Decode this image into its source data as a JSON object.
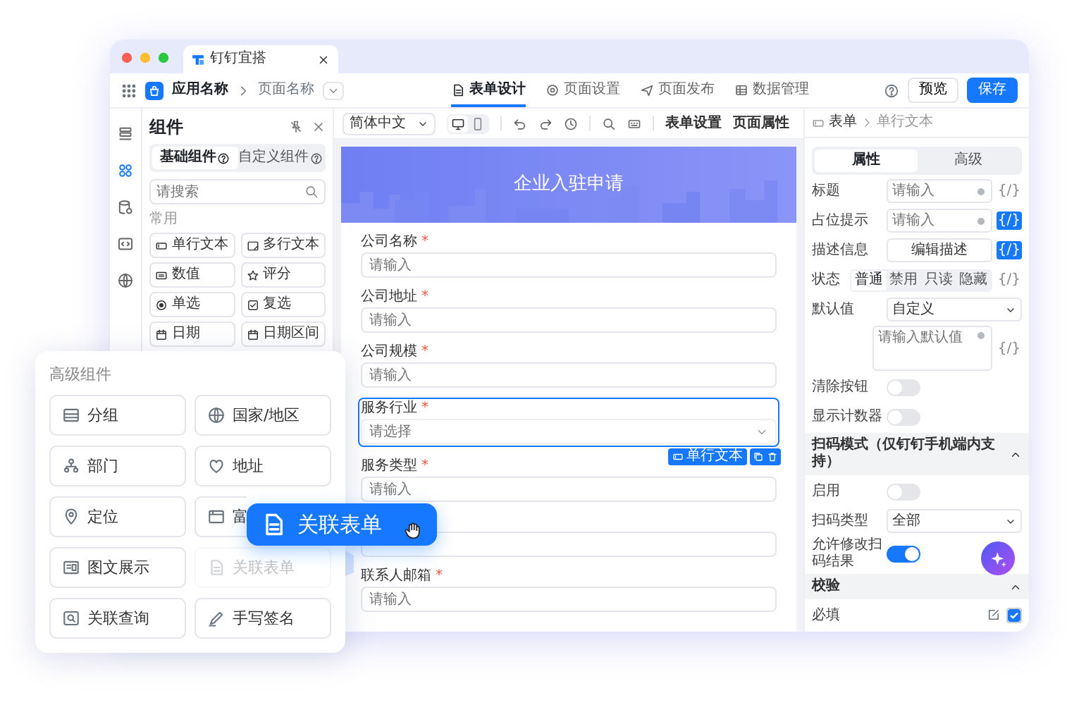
{
  "browser_tab": {
    "title": "钉钉宜搭"
  },
  "header": {
    "app_name": "应用名称",
    "page_name": "页面名称",
    "tabs": [
      {
        "label": "表单设计",
        "selected": true
      },
      {
        "label": "页面设置",
        "selected": false
      },
      {
        "label": "页面发布",
        "selected": false
      },
      {
        "label": "数据管理",
        "selected": false
      }
    ],
    "buttons": [
      "预览",
      "保存"
    ]
  },
  "rail": {
    "items": [
      {
        "selected": false
      },
      {
        "selected": true
      },
      {
        "selected": false
      },
      {
        "selected": false
      },
      {
        "selected": false
      }
    ]
  },
  "components_panel": {
    "title": "组件",
    "tabs": [
      {
        "label": "基础组件",
        "selected": true
      },
      {
        "label": "自定义组件",
        "selected": false
      }
    ],
    "search": {
      "placeholder": "请搜索"
    },
    "group": "常用",
    "items": [
      "单行文本",
      "多行文本",
      "数值",
      "评分",
      "单选",
      "复选",
      "日期",
      "日期区间"
    ]
  },
  "toolbar": {
    "language": "简体中文",
    "devices": [
      {
        "selected": true
      },
      {
        "selected": false
      }
    ],
    "links": [
      "表单设置",
      "页面属性"
    ]
  },
  "form": {
    "title": "企业入驻申请",
    "fields": [
      {
        "kind": "input",
        "label": "公司名称",
        "required_mark": "*",
        "placeholder": "请输入",
        "selected": false
      },
      {
        "kind": "input",
        "label": "公司地址",
        "required_mark": "*",
        "placeholder": "请输入",
        "selected": false
      },
      {
        "kind": "input",
        "label": "公司规模",
        "required_mark": "*",
        "placeholder": "请输入",
        "selected": false
      },
      {
        "kind": "select",
        "label": "服务行业",
        "required_mark": "*",
        "placeholder": "请选择",
        "selected": true
      },
      {
        "kind": "input",
        "label": "服务类型",
        "required_mark": "*",
        "placeholder": "请输入",
        "selected": false
      },
      {
        "kind": "input",
        "selected": false
      },
      {
        "kind": "input",
        "label": "联系人邮箱",
        "required_mark": "*",
        "placeholder": "请输入",
        "selected": false
      }
    ],
    "field_toolbar": {
      "label": "单行文本"
    }
  },
  "properties": {
    "breadcrumb": [
      "表单",
      "单行文本"
    ],
    "tabs": [
      {
        "label": "属性",
        "selected": true
      },
      {
        "label": "高级",
        "selected": false
      }
    ],
    "rows": [
      {
        "kind": "input",
        "label": "标题",
        "placeholder": "请输入",
        "expr": "{/}",
        "expr_active": false
      },
      {
        "kind": "input",
        "label": "占位提示",
        "placeholder": "请输入",
        "expr": "{/}",
        "expr_active": true
      },
      {
        "kind": "button",
        "label": "描述信息",
        "value": "编辑描述",
        "expr": "{/}",
        "expr_active": true
      },
      {
        "kind": "segmented",
        "label": "状态",
        "options": [
          {
            "label": "普通",
            "selected": true
          },
          {
            "label": "禁用",
            "selected": false
          },
          {
            "label": "只读",
            "selected": false
          },
          {
            "label": "隐藏",
            "selected": false
          }
        ],
        "expr": "{/}",
        "expr_active": false
      },
      {
        "kind": "select",
        "label": "默认值",
        "value": "自定义"
      },
      {
        "kind": "textarea",
        "placeholder": "请输入默认值",
        "expr": "{/}",
        "expr_active": false
      },
      {
        "kind": "toggle",
        "label": "清除按钮",
        "on": false
      },
      {
        "kind": "toggle",
        "label": "显示计数器",
        "on": false
      },
      {
        "kind": "section",
        "label": "扫码模式（仅钉钉手机端内支持）",
        "expanded": true
      },
      {
        "kind": "toggle",
        "label": "启用",
        "on": false
      },
      {
        "kind": "select",
        "label": "扫码类型",
        "value": "全部"
      },
      {
        "kind": "toggle",
        "label": "允许修改扫码结果",
        "on": true
      },
      {
        "kind": "section",
        "label": "校验",
        "expanded": true
      },
      {
        "kind": "checkbox",
        "label": "必填",
        "checked": true
      }
    ]
  },
  "advanced_palette": {
    "title": "高级组件",
    "items": [
      {
        "label": "分组",
        "dragging": false
      },
      {
        "label": "国家/地区",
        "dragging": false
      },
      {
        "label": "部门",
        "dragging": false
      },
      {
        "label": "地址",
        "dragging": false
      },
      {
        "label": "定位",
        "dragging": false
      },
      {
        "label": "富",
        "dragging": false
      },
      {
        "label": "图文展示",
        "dragging": false
      },
      {
        "label": "关联表单",
        "dragging": true
      },
      {
        "label": "关联查询",
        "dragging": false
      },
      {
        "label": "手写签名",
        "dragging": false
      }
    ]
  },
  "drag_chip": {
    "label": "关联表单"
  }
}
